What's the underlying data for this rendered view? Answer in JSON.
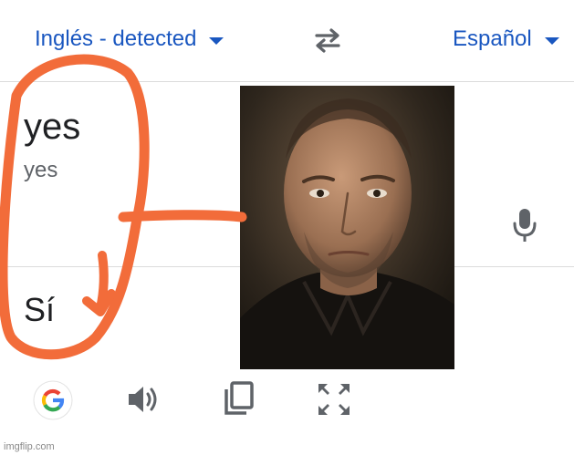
{
  "header": {
    "source_language": "Inglés - detected",
    "target_language": "Español",
    "swap_icon": "swap-arrows-icon"
  },
  "source": {
    "text": "yes",
    "transliteration": "yes",
    "mic_icon": "microphone-icon"
  },
  "result": {
    "text": "Sí"
  },
  "toolbar": {
    "icons": [
      "google-logo-icon",
      "speaker-icon",
      "copy-icon",
      "fullscreen-icon"
    ]
  },
  "overlay": {
    "photo": "portrait-photo",
    "annotation_color": "#f26c3a"
  },
  "watermark": "imgflip.com",
  "colors": {
    "accent": "#1a57c0",
    "text": "#202124",
    "muted": "#5f6368",
    "icon": "#5f6368"
  }
}
